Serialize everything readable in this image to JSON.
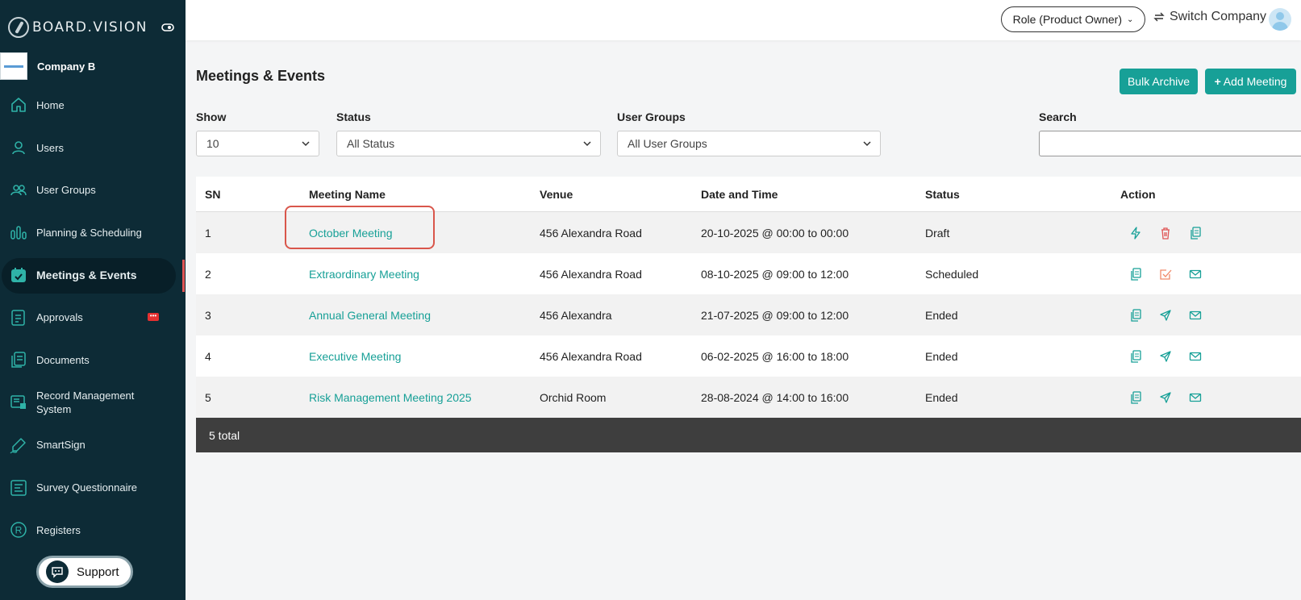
{
  "sidebar": {
    "brand": "BOARD.VISION",
    "company": "Company B",
    "items": [
      {
        "label": "Home",
        "icon": "home-icon"
      },
      {
        "label": "Users",
        "icon": "user-icon"
      },
      {
        "label": "User Groups",
        "icon": "users-icon"
      },
      {
        "label": "Planning & Scheduling",
        "icon": "chart-bars-icon"
      },
      {
        "label": "Meetings & Events",
        "icon": "calendar-check-icon",
        "active": true
      },
      {
        "label": "Approvals",
        "icon": "document-list-icon"
      },
      {
        "label": "Documents",
        "icon": "documents-icon"
      },
      {
        "label": "Record Management System",
        "icon": "record-monitor-icon"
      },
      {
        "label": "SmartSign",
        "icon": "pen-sign-icon"
      },
      {
        "label": "Survey Questionnaire",
        "icon": "survey-icon"
      },
      {
        "label": "Registers",
        "icon": "registered-icon"
      }
    ],
    "support_label": "Support"
  },
  "header": {
    "role_label": "Role (Product Owner)",
    "switch_label": "Switch Company"
  },
  "main": {
    "title": "Meetings & Events",
    "bulk_archive_label": "Bulk Archive",
    "add_meeting_label": "Add Meeting",
    "filters": {
      "show_label": "Show",
      "show_value": "10",
      "status_label": "Status",
      "status_value": "All Status",
      "groups_label": "User Groups",
      "groups_value": "All User Groups",
      "search_label": "Search",
      "search_value": ""
    },
    "table": {
      "columns": [
        "SN",
        "Meeting Name",
        "Venue",
        "Date and Time",
        "Status",
        "Action"
      ],
      "rows": [
        {
          "sn": "1",
          "name": "October Meeting",
          "venue": "456 Alexandra Road",
          "datetime": "20-10-2025 @ 00:00 to 00:00",
          "status": "Draft",
          "actions": [
            "lightning-icon",
            "trash-icon",
            "copy-icon"
          ]
        },
        {
          "sn": "2",
          "name": "Extraordinary Meeting",
          "venue": "456 Alexandra Road",
          "datetime": "08-10-2025 @ 09:00 to 12:00",
          "status": "Scheduled",
          "actions": [
            "copy-icon",
            "checkbox-edit-icon",
            "mail-icon"
          ]
        },
        {
          "sn": "3",
          "name": "Annual General Meeting",
          "venue": "456 Alexandra",
          "datetime": "21-07-2025 @ 09:00 to 12:00",
          "status": "Ended",
          "actions": [
            "copy-icon",
            "send-icon",
            "mail-icon"
          ]
        },
        {
          "sn": "4",
          "name": "Executive Meeting",
          "venue": "456 Alexandra Road",
          "datetime": "06-02-2025 @ 16:00 to 18:00",
          "status": "Ended",
          "actions": [
            "copy-icon",
            "send-icon",
            "mail-icon"
          ]
        },
        {
          "sn": "5",
          "name": "Risk Management Meeting 2025",
          "venue": "Orchid Room",
          "datetime": "28-08-2024 @ 14:00 to 16:00",
          "status": "Ended",
          "actions": [
            "copy-icon",
            "send-icon",
            "mail-icon"
          ]
        }
      ],
      "footer": "5 total"
    }
  },
  "colors": {
    "sidebar_bg": "#0d2b36",
    "accent": "#17a097",
    "danger": "#e05555",
    "highlight_box": "#d9564b"
  }
}
